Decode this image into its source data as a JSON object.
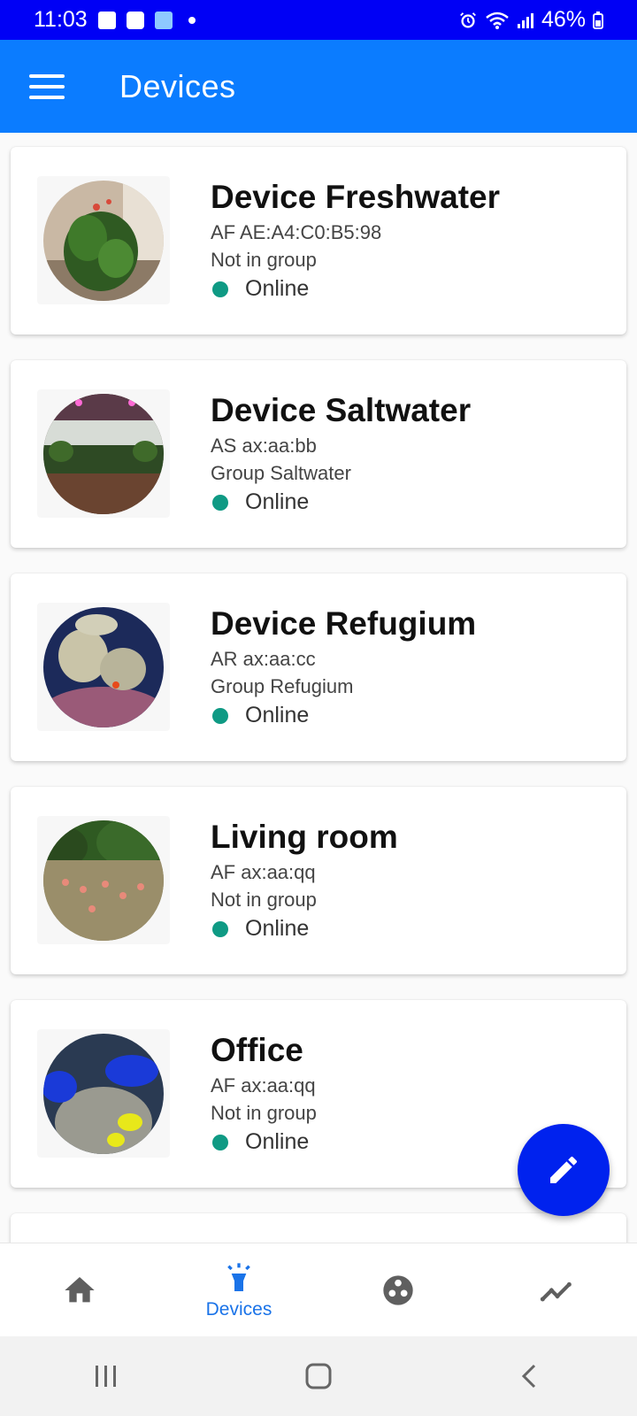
{
  "status_bar": {
    "time": "11:03",
    "battery": "46%",
    "icons": [
      "gallery-icon",
      "camera-icon",
      "location-icon",
      "dot-icon",
      "alarm-icon",
      "wifi-icon",
      "signal-icon",
      "battery-icon"
    ]
  },
  "app_bar": {
    "title": "Devices",
    "menu_icon": "menu-icon"
  },
  "devices": [
    {
      "name": "Device Freshwater",
      "id": "AF AE:A4:C0:B5:98",
      "group": "Not in group",
      "status": "Online"
    },
    {
      "name": "Device Saltwater",
      "id": "AS ax:aa:bb",
      "group": "Group Saltwater",
      "status": "Online"
    },
    {
      "name": "Device Refugium",
      "id": "AR ax:aa:cc",
      "group": "Group Refugium",
      "status": "Online"
    },
    {
      "name": "Living room",
      "id": "AF ax:aa:qq",
      "group": "Not in group",
      "status": "Online"
    },
    {
      "name": "Office",
      "id": "AF ax:aa:qq",
      "group": "Not in group",
      "status": "Online"
    }
  ],
  "fab": {
    "icon": "pencil-icon"
  },
  "bottom_nav": {
    "items": [
      {
        "icon": "home-icon",
        "label": ""
      },
      {
        "icon": "lamp-icon",
        "label": "Devices",
        "active": true
      },
      {
        "icon": "groups-icon",
        "label": ""
      },
      {
        "icon": "chart-icon",
        "label": ""
      }
    ]
  },
  "colors": {
    "status_bar": "#0000f5",
    "app_bar": "#0b7cff",
    "fab": "#0022ee",
    "online": "#0f9a84",
    "nav_active": "#1a73e8"
  }
}
